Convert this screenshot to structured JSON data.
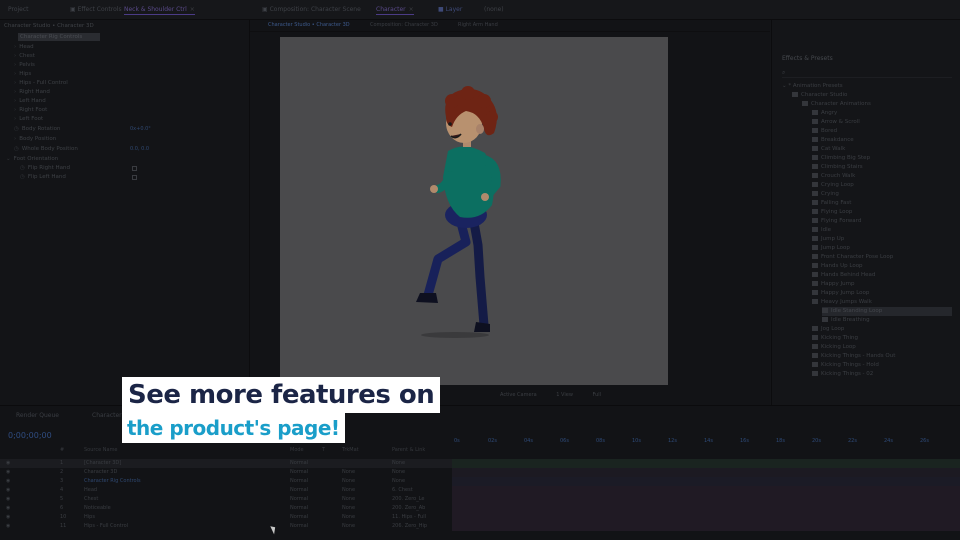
{
  "tabs": {
    "project": "Project",
    "effect_controls": "Effect Controls",
    "effect_controls_target": "Neck & Shoulder Ctrl",
    "composition": "Composition: Character Scene",
    "composition_target": "Character",
    "layer": "Layer",
    "layer_target": "(none)"
  },
  "effect_controls": {
    "header": "Character Studio • Character 3D",
    "selected_item": "Character Rig Controls",
    "rows": [
      "Head",
      "Chest",
      "Pelvis",
      "Hips",
      "Hips - Full Control",
      "Right Hand",
      "Left Hand",
      "Right Foot",
      "Left Foot",
      "Body Rotation",
      "Body Position",
      "Whole Body Position",
      "Foot Orientation",
      "Flip Right Hand",
      "Flip Left Hand"
    ],
    "rotation_value": "0x+0.0°",
    "position_value": "0.0, 0.0"
  },
  "viewer": {
    "tabs": [
      "Character Studio • Character 3D",
      "Composition: Character 3D",
      "Right Arm Hand"
    ],
    "footer_view": "1 View",
    "footer_camera": "Active Camera",
    "footer_quality": "Full"
  },
  "effects_presets": {
    "title": "Effects & Presets",
    "search_placeholder": "",
    "tree": [
      "* Animation Presets",
      "Character Studio",
      "Character Animations",
      "Angry",
      "Arrow & Scroll",
      "Bored",
      "Breakdance",
      "Cat Walk",
      "Climbing Big Step",
      "Climbing Stairs",
      "Crouch Walk",
      "Crying Loop",
      "Crying",
      "Falling Fast",
      "Flying Loop",
      "Flying Forward",
      "Idle",
      "Jump Up",
      "Jump Loop",
      "Front Character Pose Loop",
      "Hands Up Loop",
      "Hands Behind Head",
      "Happy Jump",
      "Happy Jump Loop",
      "Heavy Jumps Walk",
      "Idle Standing Loop",
      "Idle Breathing",
      "Jog Loop",
      "Kicking Thing",
      "Kicking Loop",
      "Kicking Things - Hands Out",
      "Kicking Things - Hold",
      "Kicking Things - 02"
    ],
    "selected_index": 25
  },
  "timeline": {
    "tab_render": "Render Queue",
    "tab_comp": "Character 3D",
    "timecode": "0;00;00;00",
    "column_headers": [
      "#",
      "Source Name",
      "Mode",
      "T",
      "TrkMat",
      "Parent & Link"
    ],
    "layers": [
      {
        "num": "1",
        "name": "[Character 3D]",
        "mode": "Normal",
        "trkmat": "",
        "parent": "None"
      },
      {
        "num": "2",
        "name": "Character 3D",
        "mode": "Normal",
        "trkmat": "None",
        "parent": "None"
      },
      {
        "num": "3",
        "name": "Character Rig Controls",
        "mode": "Normal",
        "trkmat": "None",
        "parent": "None"
      },
      {
        "num": "4",
        "name": "Head",
        "mode": "Normal",
        "trkmat": "None",
        "parent": "6. Chest"
      },
      {
        "num": "5",
        "name": "Chest",
        "mode": "Normal",
        "trkmat": "None",
        "parent": "200. Zero_Le"
      },
      {
        "num": "6",
        "name": "Noticeable",
        "mode": "Normal",
        "trkmat": "None",
        "parent": "200. Zero_Ab"
      },
      {
        "num": "10",
        "name": "Hips",
        "mode": "Normal",
        "trkmat": "None",
        "parent": "11. Hips - Full"
      },
      {
        "num": "11",
        "name": "Hips - Full Control",
        "mode": "Normal",
        "trkmat": "None",
        "parent": "206. Zero_Hip"
      }
    ],
    "ruler_ticks": [
      "0s",
      "02s",
      "04s",
      "06s",
      "08s",
      "10s",
      "12s",
      "14s",
      "16s",
      "18s",
      "20s",
      "22s",
      "24s",
      "26s"
    ]
  },
  "callout": {
    "line1": "See more features on",
    "line2": "the product's page!"
  },
  "colors": {
    "callout_bg": "#ffffff",
    "callout_dark_text": "#1b2546",
    "callout_accent_text": "#1a9ec9",
    "hair": "#a0301c",
    "shirt": "#0f9b86",
    "pants": "#1d2a6e",
    "skin": "#f1c29a"
  }
}
